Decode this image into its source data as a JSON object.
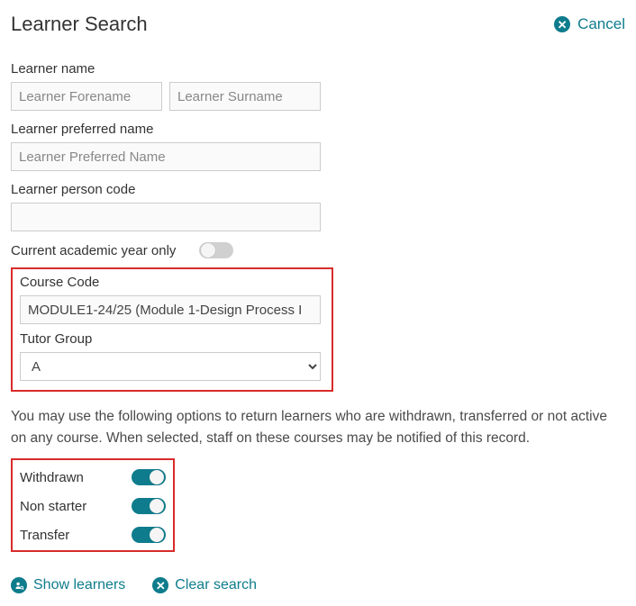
{
  "header": {
    "title": "Learner Search",
    "cancel": "Cancel"
  },
  "fields": {
    "learner_name_label": "Learner name",
    "forename_placeholder": "Learner Forename",
    "surname_placeholder": "Learner Surname",
    "preferred_name_label": "Learner preferred name",
    "preferred_name_placeholder": "Learner Preferred Name",
    "person_code_label": "Learner person code",
    "academic_year_label": "Current academic year only",
    "course_code_label": "Course Code",
    "course_code_value": "MODULE1-24/25 (Module 1-Design Process I",
    "tutor_group_label": "Tutor Group",
    "tutor_group_value": "A"
  },
  "help_text": "You may use the following options to return learners who are withdrawn, transferred or not active on any course. When selected, staff on these courses may be notified of this record.",
  "statuses": {
    "withdrawn": "Withdrawn",
    "non_starter": "Non starter",
    "transfer": "Transfer"
  },
  "actions": {
    "show_learners": "Show learners",
    "clear_search": "Clear search"
  }
}
